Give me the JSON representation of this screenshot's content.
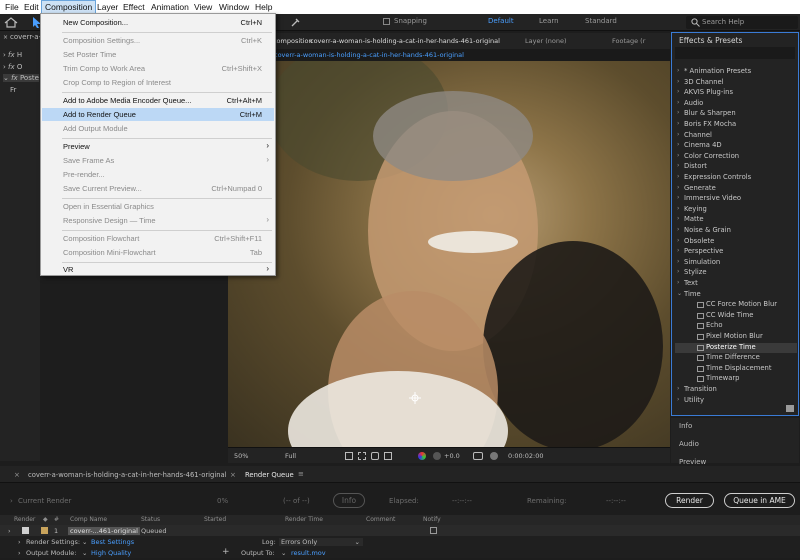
{
  "menubar": [
    "File",
    "Edit",
    "Composition",
    "Layer",
    "Effect",
    "Animation",
    "View",
    "Window",
    "Help"
  ],
  "toolbar": {
    "snapping": "Snapping",
    "workspaces": [
      "Default",
      "Learn",
      "Standard"
    ],
    "search_placeholder": "Search Help"
  },
  "project": {
    "tab": "coverr-a-wo",
    "rows": [
      "H",
      "O",
      "Poste",
      "Fr"
    ]
  },
  "viewer": {
    "tab_prefix": "Composition",
    "tab_name": "coverr-a-woman-is-holding-a-cat-in-her-hands-461-original",
    "layer_tab": "Layer (none)",
    "footage_tab": "Footage (r",
    "breadcrumb": "coverr-a-woman-is-holding-a-cat-in-her-hands-461-original",
    "zoom": "50%",
    "resolution": "Full",
    "exposure": "+0.0",
    "timecode": "0:00:02:00"
  },
  "menu": {
    "items": [
      {
        "label": "New Composition...",
        "shortcut": "Ctrl+N",
        "enabled": true
      },
      {
        "sep": true
      },
      {
        "label": "Composition Settings...",
        "shortcut": "Ctrl+K",
        "enabled": false
      },
      {
        "label": "Set Poster Time",
        "shortcut": "",
        "enabled": false
      },
      {
        "label": "Trim Comp to Work Area",
        "shortcut": "Ctrl+Shift+X",
        "enabled": false
      },
      {
        "label": "Crop Comp to Region of Interest",
        "shortcut": "",
        "enabled": false
      },
      {
        "sep": true
      },
      {
        "label": "Add to Adobe Media Encoder Queue...",
        "shortcut": "Ctrl+Alt+M",
        "enabled": true
      },
      {
        "label": "Add to Render Queue",
        "shortcut": "Ctrl+M",
        "enabled": true,
        "highlighted": true
      },
      {
        "label": "Add Output Module",
        "shortcut": "",
        "enabled": false
      },
      {
        "sep": true
      },
      {
        "label": "Preview",
        "shortcut": "",
        "enabled": true,
        "submenu": true
      },
      {
        "label": "Save Frame As",
        "shortcut": "",
        "enabled": false,
        "submenu": true
      },
      {
        "label": "Pre-render...",
        "shortcut": "",
        "enabled": false
      },
      {
        "label": "Save Current Preview...",
        "shortcut": "Ctrl+Numpad 0",
        "enabled": false
      },
      {
        "sep": true
      },
      {
        "label": "Open in Essential Graphics",
        "shortcut": "",
        "enabled": false
      },
      {
        "label": "Responsive Design — Time",
        "shortcut": "",
        "enabled": false,
        "submenu": true
      },
      {
        "sep": true
      },
      {
        "label": "Composition Flowchart",
        "shortcut": "Ctrl+Shift+F11",
        "enabled": false
      },
      {
        "label": "Composition Mini-Flowchart",
        "shortcut": "Tab",
        "enabled": false
      },
      {
        "sep": true
      },
      {
        "label": "VR",
        "shortcut": "",
        "enabled": true,
        "submenu": true
      }
    ]
  },
  "effects": {
    "title": "Effects & Presets",
    "categories": [
      "* Animation Presets",
      "3D Channel",
      "AKVIS Plug-ins",
      "Audio",
      "Blur & Sharpen",
      "Boris FX Mocha",
      "Channel",
      "Cinema 4D",
      "Color Correction",
      "Distort",
      "Expression Controls",
      "Generate",
      "Immersive Video",
      "Keying",
      "Matte",
      "Noise & Grain",
      "Obsolete",
      "Perspective",
      "Simulation",
      "Stylize",
      "Text",
      "Time"
    ],
    "time_items": [
      "CC Force Motion Blur",
      "CC Wide Time",
      "Echo",
      "Pixel Motion Blur",
      "Posterize Time",
      "Time Difference",
      "Time Displacement",
      "Timewarp"
    ],
    "selected": "Posterize Time",
    "after": [
      "Transition",
      "Utility"
    ]
  },
  "right_stack": [
    "Info",
    "Audio",
    "Preview"
  ],
  "render_queue": {
    "tabs": [
      "coverr-a-woman-is-holding-a-cat-in-her-hands-461-original",
      "Render Queue"
    ],
    "current_render_label": "Current Render",
    "percent": "0%",
    "of_text": "(-- of --)",
    "info": "Info",
    "elapsed_label": "Elapsed:",
    "elapsed_value": "--:--:--",
    "remaining_label": "Remaining:",
    "remaining_value": "--:--:--",
    "render_button": "Render",
    "ame_button": "Queue in AME",
    "columns": [
      "Render",
      "#",
      "Comp Name",
      "Status",
      "Started",
      "Render Time",
      "Comment",
      "Notify"
    ],
    "item": {
      "number": "1",
      "comp": "coverr-...461-original",
      "status": "Queued"
    },
    "render_settings_label": "Render Settings:",
    "render_settings_value": "Best Settings",
    "log_label": "Log:",
    "log_value": "Errors Only",
    "output_module_label": "Output Module:",
    "output_module_value": "High Quality",
    "output_to_label": "Output To:",
    "output_to_value": "result.mov"
  }
}
